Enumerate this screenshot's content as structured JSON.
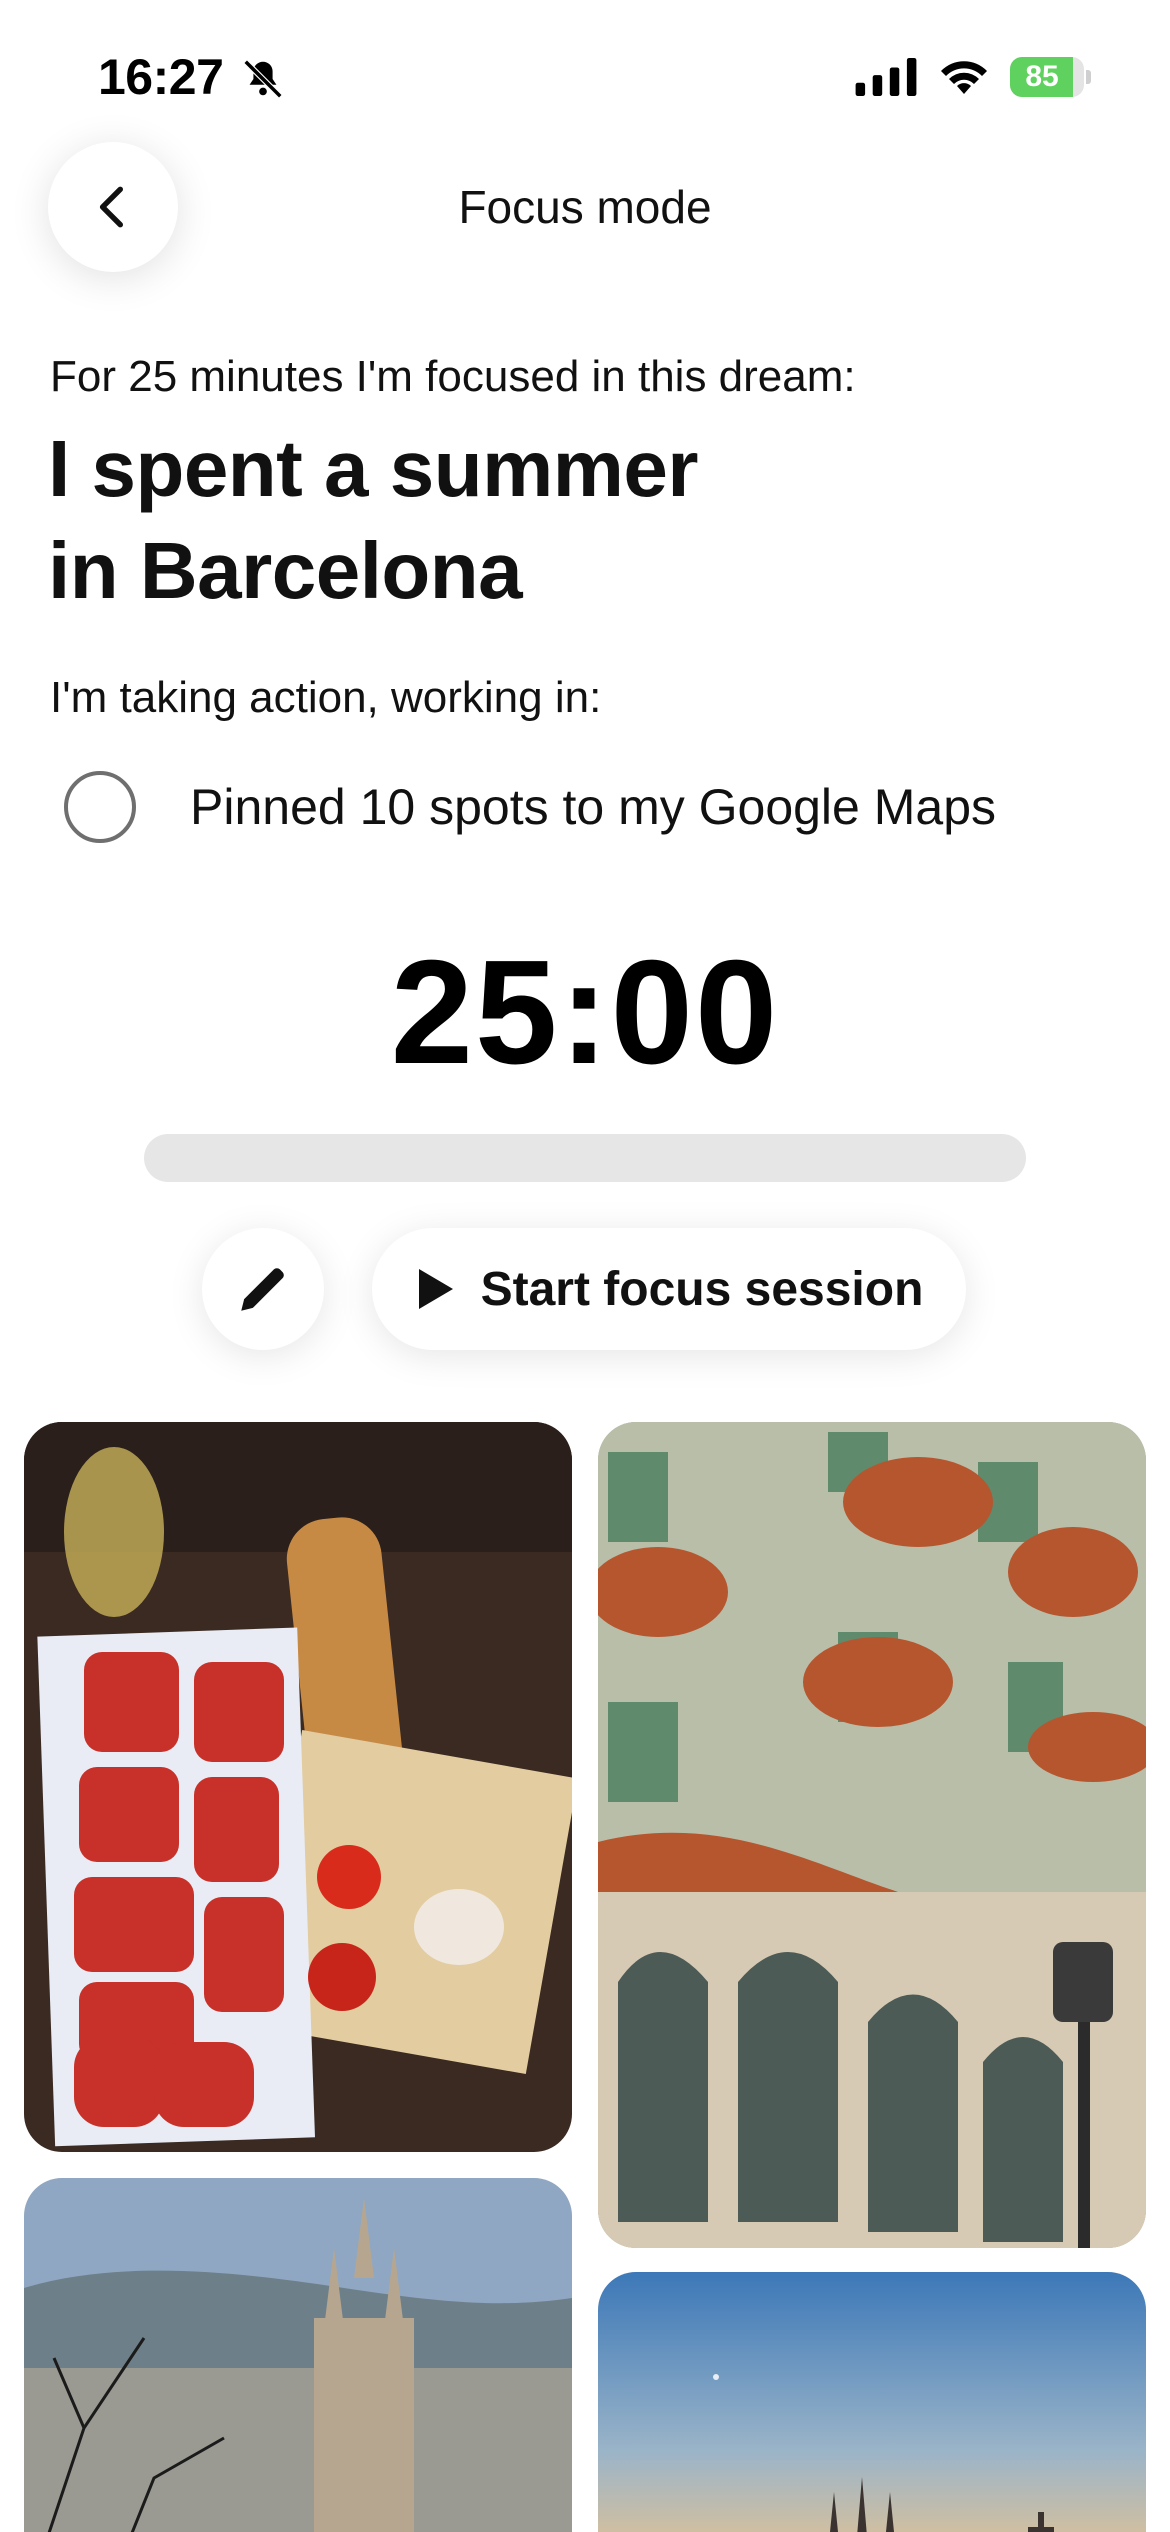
{
  "status_bar": {
    "time": "16:27",
    "battery_level": "85",
    "battery_fraction": 0.85,
    "icons": [
      "bell-slash-icon",
      "cellular-signal-icon",
      "wifi-icon",
      "battery-charging-icon"
    ]
  },
  "header": {
    "title": "Focus mode",
    "back_icon": "chevron-left-icon"
  },
  "dream": {
    "intro": "For 25 minutes I'm focused in this dream:",
    "title": "I spent a summer in Barcelona",
    "action_label": "I'm taking action, working in:",
    "task": {
      "label": "Pinned 10 spots to my Google Maps",
      "checked": false
    }
  },
  "timer": {
    "display": "25:00",
    "progress_fraction": 0
  },
  "controls": {
    "edit_icon": "pencil-icon",
    "start_icon": "play-icon",
    "start_label": "Start focus session"
  },
  "colors": {
    "battery_green": "#5fd15e",
    "progress_track": "#e6e6e6",
    "text_primary": "#111111"
  },
  "gallery": {
    "images": [
      {
        "name": "photo-pa-amb-tomaquet"
      },
      {
        "name": "photo-casa-batllo"
      },
      {
        "name": "photo-sagrada-familia-skyline"
      },
      {
        "name": "photo-sunset-skyline"
      }
    ]
  }
}
